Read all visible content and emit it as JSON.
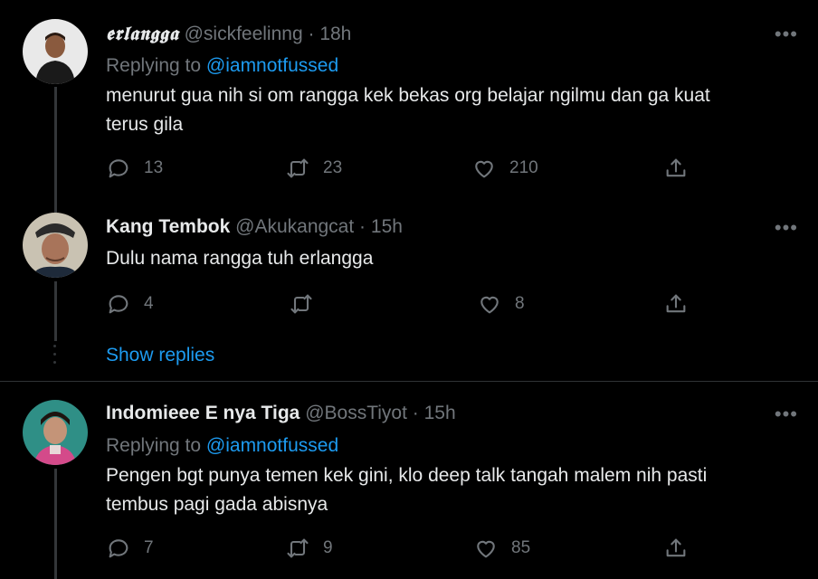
{
  "tweets": [
    {
      "name": "𝖊𝖗𝖑𝖆𝖓𝖌𝖌𝖆",
      "handle": "@sickfeelinng",
      "dot": "·",
      "time": "18h",
      "replying_prefix": "Replying to",
      "replying_to": "@iamnotfussed",
      "text_lines": [
        "menurut gua nih si om rangga kek bekas org belajar ngilmu dan ga kuat",
        "terus gila"
      ],
      "replies": "13",
      "retweets": "23",
      "likes": "210",
      "more": "•••"
    },
    {
      "name": "Kang Tembok",
      "handle": "@Akukangcat",
      "dot": "·",
      "time": "15h",
      "text_lines": [
        "Dulu nama rangga tuh erlangga"
      ],
      "replies": "4",
      "retweets": "",
      "likes": "8",
      "more": "•••"
    },
    {
      "name": "Indomieee E nya Tiga",
      "handle": "@BossTiyot",
      "dot": "·",
      "time": "15h",
      "replying_prefix": "Replying to",
      "replying_to": "@iamnotfussed",
      "text_lines": [
        "Pengen bgt punya temen kek gini, klo deep talk tangah malem nih pasti",
        "tembus pagi gada abisnya"
      ],
      "replies": "7",
      "retweets": "9",
      "likes": "85",
      "more": "•••"
    }
  ],
  "show_replies": "Show replies",
  "colors": {
    "background": "#000000",
    "text": "#e7e9ea",
    "secondary": "#71767b",
    "accent": "#1d9bf0",
    "divider": "#2f3336"
  },
  "icons": [
    "reply-icon",
    "retweet-icon",
    "like-icon",
    "share-icon",
    "more-icon"
  ]
}
